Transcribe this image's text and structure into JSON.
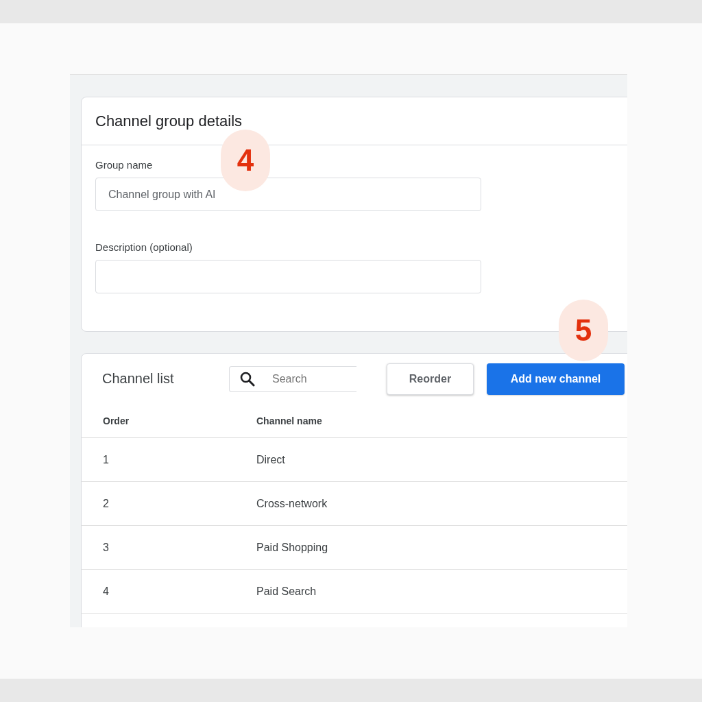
{
  "details_card": {
    "title": "Channel group details",
    "fields": [
      {
        "label": "Group name",
        "value": "Channel group with AI"
      },
      {
        "label": "Description (optional)"
      }
    ]
  },
  "channel_list": {
    "title": "Channel list",
    "search": {
      "placeholder": "Search"
    },
    "buttons": [
      {
        "label": "Reorder",
        "kind": "secondary"
      },
      {
        "label": "Add new channel",
        "kind": "primary"
      }
    ],
    "table": {
      "columns": [
        "Order",
        "Channel name"
      ],
      "rows": [
        [
          "1",
          "Direct"
        ],
        [
          "2",
          "Cross-network"
        ],
        [
          "3",
          "Paid Shopping"
        ],
        [
          "4",
          "Paid Search"
        ]
      ]
    }
  },
  "annotations": [
    {
      "label": "4"
    },
    {
      "label": "5"
    }
  ]
}
